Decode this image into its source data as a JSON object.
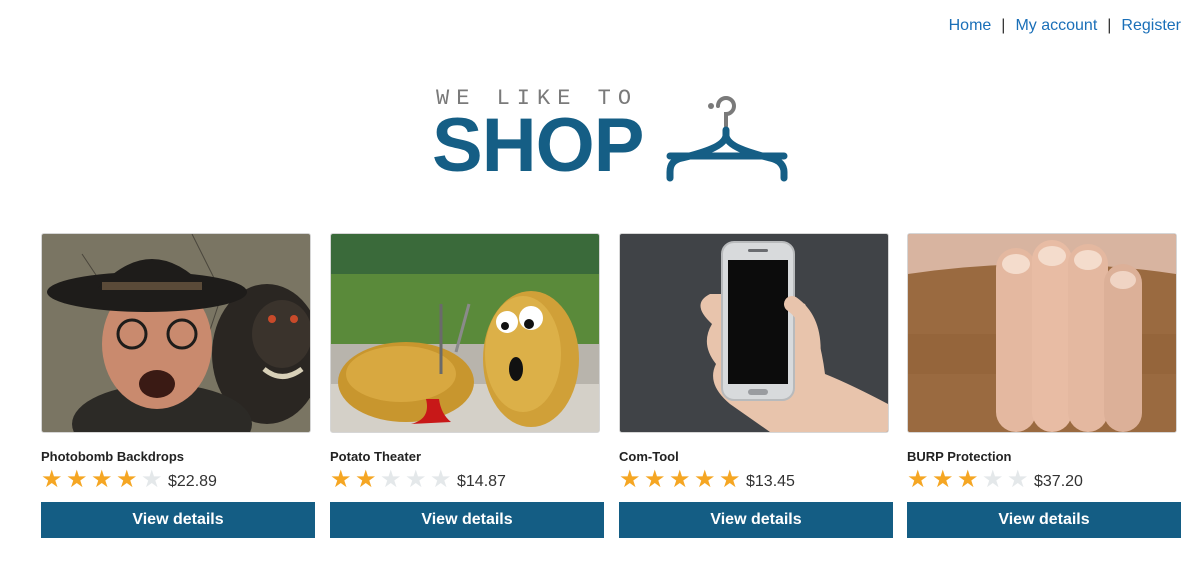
{
  "nav": {
    "home": "Home",
    "my_account": "My account",
    "register": "Register",
    "separator": "|"
  },
  "logo": {
    "tagline": "WE LIKE TO",
    "brand": "SHOP"
  },
  "colors": {
    "brand": "#155e85",
    "link": "#1a6fb8",
    "star_on": "#f5a623",
    "star_off": "#e4e8ea",
    "button": "#145d84"
  },
  "products": [
    {
      "name": "Photobomb Backdrops",
      "rating": 4,
      "max_rating": 5,
      "price": "$22.89",
      "button": "View details",
      "image": "old-man-with-monkey-photo"
    },
    {
      "name": "Potato Theater",
      "rating": 2,
      "max_rating": 5,
      "price": "$14.87",
      "button": "View details",
      "image": "potatoes-photo"
    },
    {
      "name": "Com-Tool",
      "rating": 5,
      "max_rating": 5,
      "price": "$13.45",
      "button": "View details",
      "image": "hand-holding-phone-photo"
    },
    {
      "name": "BURP Protection",
      "rating": 3,
      "max_rating": 5,
      "price": "$37.20",
      "button": "View details",
      "image": "hand-over-beard-photo"
    }
  ]
}
